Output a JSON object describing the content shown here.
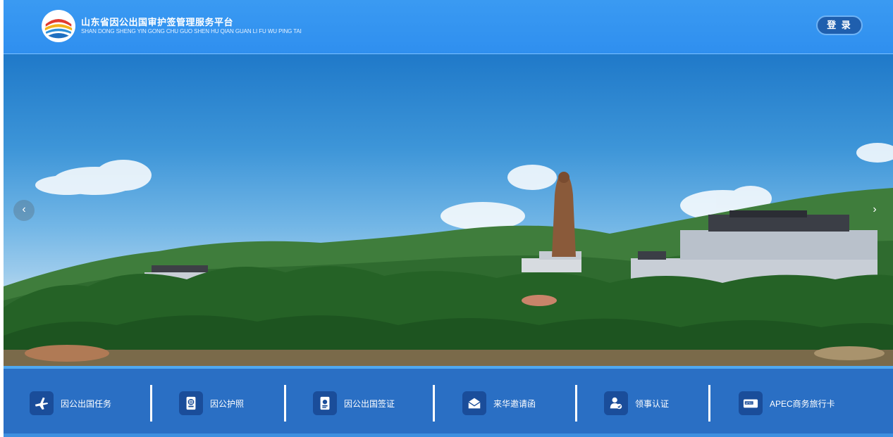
{
  "header": {
    "title_cn": "山东省因公出国审护签管理服务平台",
    "title_en": "SHAN DONG SHENG YIN GONG CHU GUO SHEN HU QIAN GUAN LI FU WU PING TAI",
    "login_label": "登 录"
  },
  "banner": {
    "prev_label": "‹",
    "next_label": "›"
  },
  "nav": {
    "items": [
      {
        "label": "因公出国任务",
        "icon": "airplane-icon"
      },
      {
        "label": "因公护照",
        "icon": "passport-icon"
      },
      {
        "label": "因公出国签证",
        "icon": "visa-icon"
      },
      {
        "label": "来华邀请函",
        "icon": "envelope-icon"
      },
      {
        "label": "领事认证",
        "icon": "certification-icon"
      },
      {
        "label": "APEC商务旅行卡",
        "icon": "apec-card-icon"
      }
    ]
  },
  "colors": {
    "header_bg": "#2f8fef",
    "nav_bg": "#2a6fc4",
    "login_bg": "#1f5fae"
  }
}
